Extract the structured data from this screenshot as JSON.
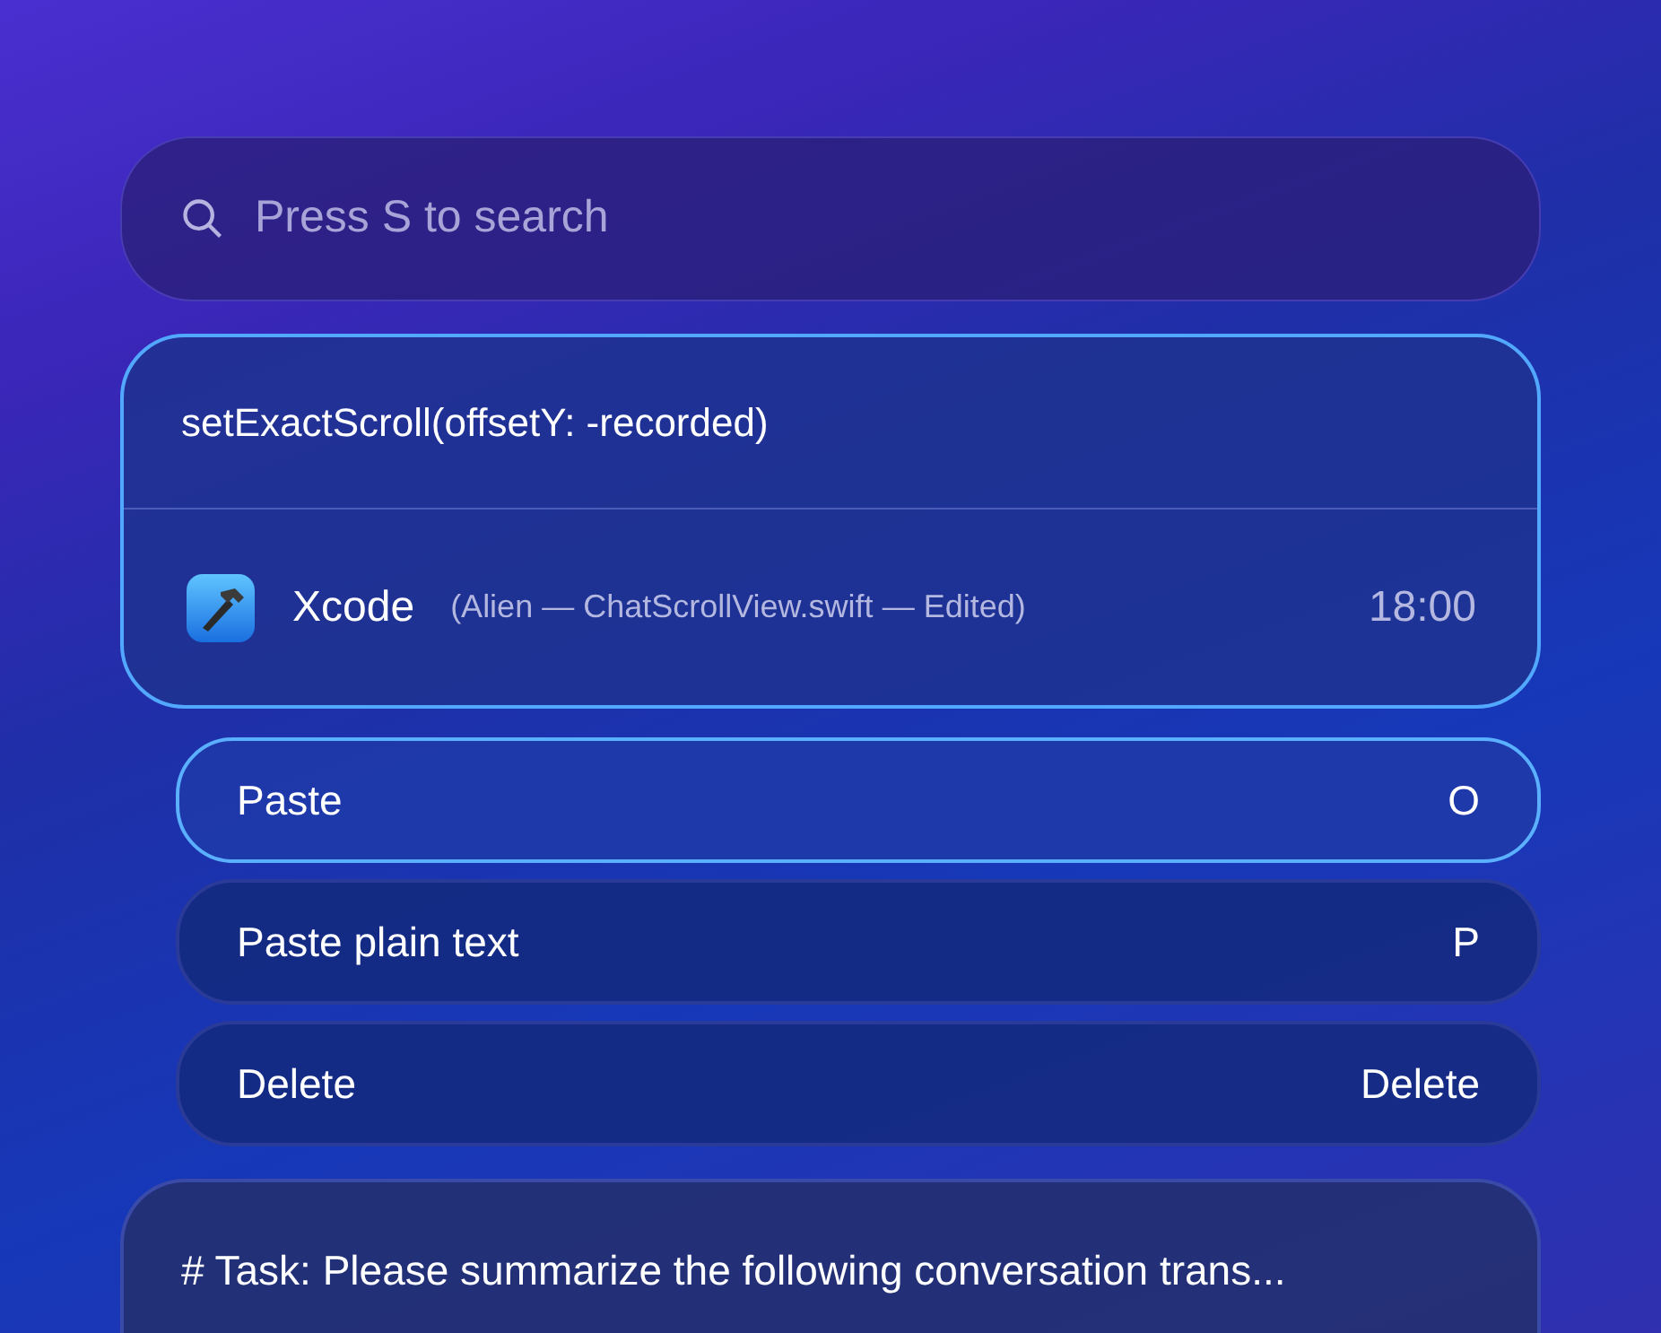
{
  "search": {
    "placeholder": "Press S to search"
  },
  "clip": {
    "text": "setExactScroll(offsetY: -recorded)",
    "app": "Xcode",
    "window": "(Alien — ChatScrollView.swift — Edited)",
    "time": "18:00",
    "selected": true
  },
  "actions": [
    {
      "label": "Paste",
      "shortcut": "O",
      "selected": true
    },
    {
      "label": "Paste plain text",
      "shortcut": "P",
      "selected": false
    },
    {
      "label": "Delete",
      "shortcut": "Delete",
      "selected": false
    }
  ],
  "next_clip": {
    "text": "# Task: Please summarize the following conversation trans...",
    "selected": false
  }
}
